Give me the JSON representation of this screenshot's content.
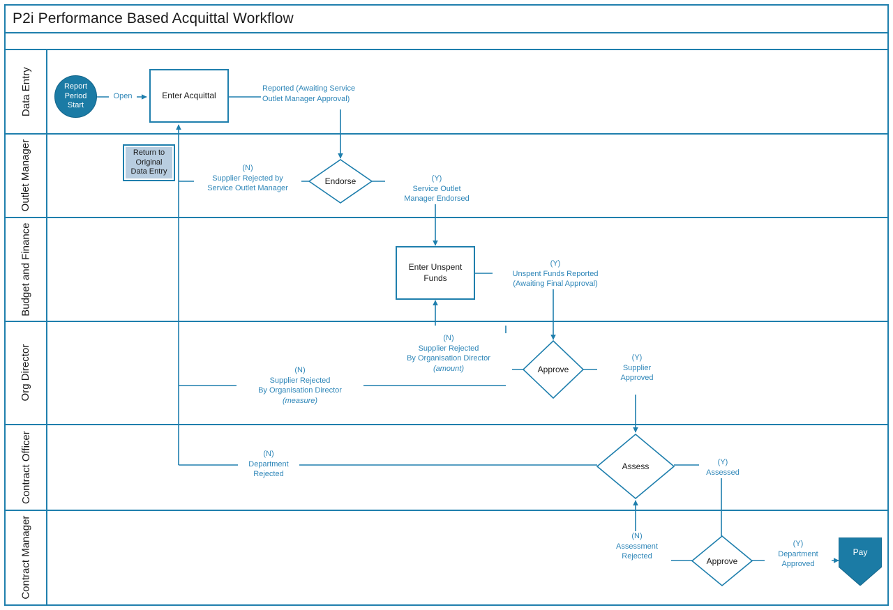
{
  "diagram": {
    "title": "P2i Performance Based Acquittal Workflow",
    "accent_color": "#1f7fad",
    "label_color": "#2e86b8",
    "fill_color": "#1b7ba5",
    "return_fill": "#b8cde0"
  },
  "lanes": [
    {
      "id": "data-entry",
      "label": "Data Entry"
    },
    {
      "id": "outlet-manager",
      "label": "Outlet\nManager"
    },
    {
      "id": "budget-finance",
      "label": "Budget and\nFinance"
    },
    {
      "id": "org-director",
      "label": "Org Director"
    },
    {
      "id": "contract-officer",
      "label": "Contract\nOfficer"
    },
    {
      "id": "contract-manager",
      "label": "Contract\nManager"
    }
  ],
  "nodes": {
    "report_period_start": "Report\nPeriod\nStart",
    "enter_acquittal": "Enter Acquittal",
    "return_original": "Return to\nOriginal\nData Entry",
    "endorse": "Endorse",
    "enter_unspent_funds": "Enter Unspent\nFunds",
    "approve_org": "Approve",
    "assess": "Assess",
    "approve_contract": "Approve",
    "pay": "Pay"
  },
  "edges": {
    "open": "Open",
    "reported": "Reported (Awaiting Service\nOutlet Manager Approval)",
    "supplier_rejected_som": "(N)\nSupplier Rejected by\nService Outlet Manager",
    "som_endorsed": "(Y)\nService Outlet\nManager Endorsed",
    "unspent_reported": "(Y)\nUnspent Funds Reported\n(Awaiting Final Approval)",
    "rejected_org_amount_l1": "(N)",
    "rejected_org_amount_l2": "Supplier Rejected",
    "rejected_org_amount_l3": "By Organisation Director",
    "rejected_org_amount_l4": "(amount)",
    "rejected_org_measure_l1": "(N)",
    "rejected_org_measure_l2": "Supplier Rejected",
    "rejected_org_measure_l3": "By Organisation Director",
    "rejected_org_measure_l4": "(measure)",
    "supplier_approved": "(Y)\nSupplier\nApproved",
    "department_rejected": "(N)\nDepartment\nRejected",
    "assessed": "(Y)\nAssessed",
    "assessment_rejected": "(N)\nAssessment\nRejected",
    "department_approved": "(Y)\nDepartment\nApproved"
  },
  "chart_data": {
    "type": "table",
    "title": "P2i Performance Based Acquittal Workflow",
    "swimlanes": [
      "Data Entry",
      "Outlet Manager",
      "Budget and Finance",
      "Org Director",
      "Contract Officer",
      "Contract Manager"
    ],
    "steps": [
      {
        "lane": "Data Entry",
        "node": "Report Period Start",
        "shape": "start-circle"
      },
      {
        "lane": "Data Entry",
        "node": "Enter Acquittal",
        "shape": "process"
      },
      {
        "lane": "Outlet Manager",
        "node": "Return to Original Data Entry",
        "shape": "off-page"
      },
      {
        "lane": "Outlet Manager",
        "node": "Endorse",
        "shape": "decision"
      },
      {
        "lane": "Budget and Finance",
        "node": "Enter Unspent Funds",
        "shape": "process"
      },
      {
        "lane": "Org Director",
        "node": "Approve",
        "shape": "decision"
      },
      {
        "lane": "Contract Officer",
        "node": "Assess",
        "shape": "decision"
      },
      {
        "lane": "Contract Manager",
        "node": "Approve",
        "shape": "decision"
      },
      {
        "lane": "Contract Manager",
        "node": "Pay",
        "shape": "terminator"
      }
    ],
    "transitions": [
      {
        "from": "Report Period Start",
        "to": "Enter Acquittal",
        "label": "Open"
      },
      {
        "from": "Enter Acquittal",
        "to": "Endorse",
        "label": "Reported (Awaiting Service Outlet Manager Approval)"
      },
      {
        "from": "Endorse",
        "to": "Return to Original Data Entry",
        "label": "(N) Supplier Rejected by Service Outlet Manager"
      },
      {
        "from": "Endorse",
        "to": "Enter Unspent Funds",
        "label": "(Y) Service Outlet Manager Endorsed"
      },
      {
        "from": "Enter Unspent Funds",
        "to": "Approve (Org Director)",
        "label": "(Y) Unspent Funds Reported (Awaiting Final Approval)"
      },
      {
        "from": "Approve (Org Director)",
        "to": "Enter Unspent Funds",
        "label": "(N) Supplier Rejected By Organisation Director (amount)"
      },
      {
        "from": "Approve (Org Director)",
        "to": "Enter Acquittal",
        "label": "(N) Supplier Rejected By Organisation Director (measure)"
      },
      {
        "from": "Approve (Org Director)",
        "to": "Assess",
        "label": "(Y) Supplier Approved"
      },
      {
        "from": "Assess",
        "to": "Enter Acquittal",
        "label": "(N) Department Rejected"
      },
      {
        "from": "Assess",
        "to": "Approve (Contract Manager)",
        "label": "(Y) Assessed"
      },
      {
        "from": "Approve (Contract Manager)",
        "to": "Assess",
        "label": "(N) Assessment Rejected"
      },
      {
        "from": "Approve (Contract Manager)",
        "to": "Pay",
        "label": "(Y) Department Approved"
      }
    ]
  }
}
